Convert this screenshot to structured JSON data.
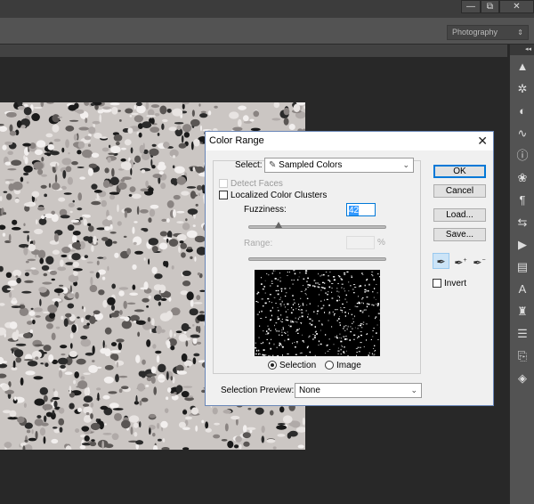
{
  "window_controls": {
    "minimize": "—",
    "restore": "⧉",
    "close": "✕"
  },
  "workspace": {
    "value": "Photography",
    "arrow": "⇕"
  },
  "panel_icons": [
    "histogram-icon",
    "navigator-icon",
    "adjustments-icon",
    "curves-icon",
    "info-icon",
    "color-icon",
    "paragraph-icon",
    "brush-icon",
    "actions-icon",
    "layers-comp-icon",
    "character-icon",
    "tool-presets-icon",
    "properties-icon",
    "clone-source-icon",
    "layers-icon"
  ],
  "dialog": {
    "title": "Color Range",
    "close": "✕",
    "select_label": "Select:",
    "select_value": "Sampled Colors",
    "detect_faces": "Detect Faces",
    "localized": "Localized Color Clusters",
    "fuzziness_label": "Fuzziness:",
    "fuzziness_value": "42",
    "fuzziness_max": 200,
    "range_label": "Range:",
    "range_value": "",
    "range_unit": "%",
    "radio_selection": "Selection",
    "radio_image": "Image",
    "selected_view": "Selection",
    "preview_label": "Selection Preview:",
    "preview_value": "None",
    "ok": "OK",
    "cancel": "Cancel",
    "load": "Load...",
    "save": "Save...",
    "invert": "Invert",
    "accent": "#0078d7"
  }
}
